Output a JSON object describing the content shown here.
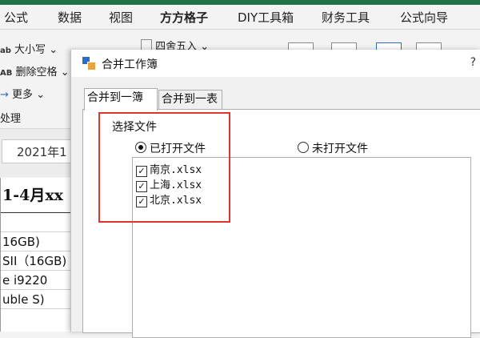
{
  "ribbon_tabs": [
    "公式",
    "数据",
    "视图",
    "方方格子",
    "DIY工具箱",
    "财务工具",
    "公式向导"
  ],
  "ribbon": {
    "case_label": "大小写",
    "space_label": "删除空格",
    "more_label": "更多",
    "group_label": "处理",
    "round_label": "四舍五入"
  },
  "namebox_value": "2021年1",
  "sheet": {
    "title": "1-4月xx",
    "rows": [
      "",
      "16GB)",
      "SII（16GB)",
      "e i9220",
      "uble S)"
    ]
  },
  "dialog": {
    "title": "合并工作簿",
    "help": "?",
    "tab_selected": "合并到一簿",
    "tab_other": "合并到一表",
    "group_label": "选择文件",
    "radio_open": "已打开文件",
    "radio_closed": "未打开文件",
    "files": [
      {
        "name": "南京.xlsx",
        "checked": true
      },
      {
        "name": "上海.xlsx",
        "checked": true
      },
      {
        "name": "北京.xlsx",
        "checked": true
      }
    ]
  },
  "colors": {
    "highlight": "#e0342f",
    "excel_green": "#1f7245"
  }
}
